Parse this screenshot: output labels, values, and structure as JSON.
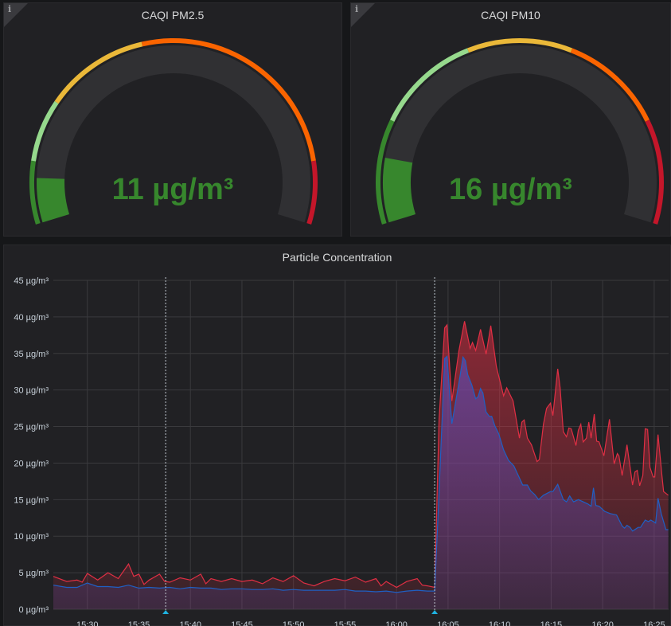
{
  "gauges": [
    {
      "title": "CAQI PM2.5",
      "value": 11,
      "value_text": "11 µg/m³",
      "max": 125,
      "thresholds": [
        {
          "to": 15,
          "color": "#37872d"
        },
        {
          "to": 30,
          "color": "#96d98d"
        },
        {
          "to": 55,
          "color": "#eab839"
        },
        {
          "to": 110,
          "color": "#fa6400"
        },
        {
          "to": 125,
          "color": "#c4162a"
        }
      ],
      "value_color": "#37872d",
      "info_icon": "i"
    },
    {
      "title": "CAQI PM10",
      "value": 16,
      "value_text": "16 µg/m³",
      "max": 125,
      "thresholds": [
        {
          "to": 25,
          "color": "#37872d"
        },
        {
          "to": 50,
          "color": "#96d98d"
        },
        {
          "to": 75,
          "color": "#eab839"
        },
        {
          "to": 100,
          "color": "#fa6400"
        },
        {
          "to": 125,
          "color": "#c4162a"
        }
      ],
      "value_color": "#37872d",
      "info_icon": "i"
    }
  ],
  "chart_data": {
    "type": "area",
    "title": "Particle Concentration",
    "x_unit": "minutes after 15:00",
    "xlim": [
      26.7,
      86.4
    ],
    "ylim": [
      0,
      45
    ],
    "ytick_labels": [
      "0 µg/m³",
      "5 µg/m³",
      "10 µg/m³",
      "15 µg/m³",
      "20 µg/m³",
      "25 µg/m³",
      "30 µg/m³",
      "35 µg/m³",
      "40 µg/m³",
      "45 µg/m³"
    ],
    "yticks": [
      0,
      5,
      10,
      15,
      20,
      25,
      30,
      35,
      40,
      45
    ],
    "xticks": [
      30,
      35,
      40,
      45,
      50,
      55,
      60,
      65,
      70,
      75,
      80,
      85
    ],
    "xtick_labels": [
      "15:30",
      "15:35",
      "15:40",
      "15:45",
      "15:50",
      "15:55",
      "16:00",
      "16:05",
      "16:10",
      "16:15",
      "16:20",
      "16:25"
    ],
    "annotations": [
      37.6,
      63.7
    ],
    "grid": true,
    "series": [
      {
        "color": "#e02f44",
        "points": [
          [
            26.7,
            4.5
          ],
          [
            28,
            3.8
          ],
          [
            29,
            4.0
          ],
          [
            29.5,
            3.7
          ],
          [
            30,
            4.9
          ],
          [
            31,
            4.0
          ],
          [
            32,
            5.0
          ],
          [
            33,
            4.2
          ],
          [
            34,
            6.2
          ],
          [
            34.5,
            4.5
          ],
          [
            35,
            4.8
          ],
          [
            35.5,
            3.4
          ],
          [
            36,
            4.0
          ],
          [
            37,
            4.8
          ],
          [
            37.5,
            3.8
          ],
          [
            38,
            3.7
          ],
          [
            39,
            4.3
          ],
          [
            40,
            4.0
          ],
          [
            41,
            4.8
          ],
          [
            41.5,
            3.5
          ],
          [
            42,
            4.2
          ],
          [
            43,
            3.8
          ],
          [
            44,
            4.2
          ],
          [
            45,
            3.8
          ],
          [
            46,
            4.0
          ],
          [
            47,
            3.5
          ],
          [
            48,
            4.3
          ],
          [
            49,
            3.8
          ],
          [
            50,
            4.6
          ],
          [
            51,
            3.6
          ],
          [
            52,
            3.2
          ],
          [
            53,
            3.8
          ],
          [
            54,
            4.2
          ],
          [
            55,
            3.9
          ],
          [
            56,
            4.4
          ],
          [
            57,
            3.7
          ],
          [
            58,
            4.2
          ],
          [
            58.5,
            3.2
          ],
          [
            59,
            3.8
          ],
          [
            60,
            3.0
          ],
          [
            61,
            3.8
          ],
          [
            62,
            4.2
          ],
          [
            62.5,
            3.3
          ],
          [
            63,
            3.2
          ],
          [
            63.7,
            3.0
          ],
          [
            64.13,
            25.9
          ],
          [
            64.67,
            38.5
          ],
          [
            64.9,
            38.9
          ],
          [
            65.37,
            28.5
          ],
          [
            66.06,
            35.4
          ],
          [
            66.6,
            39.4
          ],
          [
            67.14,
            35.7
          ],
          [
            67.37,
            36.5
          ],
          [
            67.68,
            35.4
          ],
          [
            68.15,
            38.3
          ],
          [
            68.69,
            34.9
          ],
          [
            69.15,
            38.8
          ],
          [
            69.69,
            33.2
          ],
          [
            70.39,
            29.2
          ],
          [
            70.69,
            30.3
          ],
          [
            71.31,
            28.5
          ],
          [
            71.93,
            23.4
          ],
          [
            72.16,
            25.6
          ],
          [
            72.39,
            25.9
          ],
          [
            72.7,
            23.4
          ],
          [
            73.09,
            22.5
          ],
          [
            73.63,
            20.2
          ],
          [
            73.86,
            20.5
          ],
          [
            74.25,
            25.3
          ],
          [
            74.56,
            27.5
          ],
          [
            74.94,
            28.2
          ],
          [
            75.17,
            26.5
          ],
          [
            75.64,
            32.9
          ],
          [
            75.87,
            30.3
          ],
          [
            76.18,
            24.3
          ],
          [
            76.49,
            23.6
          ],
          [
            76.72,
            24.8
          ],
          [
            76.95,
            24.7
          ],
          [
            77.41,
            22.4
          ],
          [
            77.64,
            24.5
          ],
          [
            77.88,
            25.3
          ],
          [
            78.11,
            22.9
          ],
          [
            78.42,
            23.4
          ],
          [
            78.65,
            25.6
          ],
          [
            78.88,
            23.4
          ],
          [
            79.19,
            26.7
          ],
          [
            79.42,
            23.0
          ],
          [
            79.65,
            22.9
          ],
          [
            80.12,
            21.0
          ],
          [
            80.66,
            26.0
          ],
          [
            81.12,
            19.9
          ],
          [
            81.43,
            21.3
          ],
          [
            81.58,
            21.0
          ],
          [
            81.89,
            18.3
          ],
          [
            82.36,
            22.5
          ],
          [
            82.9,
            17.0
          ],
          [
            83.13,
            18.8
          ],
          [
            83.36,
            19.0
          ],
          [
            83.59,
            16.9
          ],
          [
            83.9,
            18.3
          ],
          [
            84.13,
            24.7
          ],
          [
            84.36,
            24.6
          ],
          [
            84.59,
            19.4
          ],
          [
            84.9,
            18.1
          ],
          [
            85.06,
            18.1
          ],
          [
            85.37,
            23.9
          ],
          [
            85.75,
            18.3
          ],
          [
            85.91,
            16.1
          ],
          [
            86.37,
            15.6
          ]
        ]
      },
      {
        "color": "#1f60c4",
        "points": [
          [
            26.7,
            3.3
          ],
          [
            28,
            3.0
          ],
          [
            29,
            3.0
          ],
          [
            30,
            3.6
          ],
          [
            31,
            3.1
          ],
          [
            32,
            3.1
          ],
          [
            33,
            3.0
          ],
          [
            34,
            3.3
          ],
          [
            35,
            2.9
          ],
          [
            36,
            3.0
          ],
          [
            37,
            2.9
          ],
          [
            38,
            3.0
          ],
          [
            39,
            2.8
          ],
          [
            40,
            3.0
          ],
          [
            41,
            2.9
          ],
          [
            42,
            2.9
          ],
          [
            43,
            2.7
          ],
          [
            44,
            2.8
          ],
          [
            45,
            2.8
          ],
          [
            46,
            2.7
          ],
          [
            47,
            2.7
          ],
          [
            48,
            2.8
          ],
          [
            49,
            2.6
          ],
          [
            50,
            2.7
          ],
          [
            51,
            2.6
          ],
          [
            52,
            2.6
          ],
          [
            53,
            2.6
          ],
          [
            54,
            2.6
          ],
          [
            55,
            2.7
          ],
          [
            56,
            2.5
          ],
          [
            57,
            2.5
          ],
          [
            58,
            2.4
          ],
          [
            59,
            2.5
          ],
          [
            60,
            2.3
          ],
          [
            61,
            2.5
          ],
          [
            62,
            2.6
          ],
          [
            63,
            2.5
          ],
          [
            63.7,
            2.5
          ],
          [
            64.13,
            16.0
          ],
          [
            64.67,
            34.3
          ],
          [
            64.9,
            34.6
          ],
          [
            65.37,
            25.4
          ],
          [
            66.06,
            31.0
          ],
          [
            66.45,
            34.5
          ],
          [
            66.68,
            34.0
          ],
          [
            66.91,
            32.1
          ],
          [
            67.3,
            30.7
          ],
          [
            67.68,
            28.8
          ],
          [
            67.92,
            29.1
          ],
          [
            68.15,
            30.2
          ],
          [
            68.38,
            29.6
          ],
          [
            68.69,
            27.0
          ],
          [
            69.0,
            26.4
          ],
          [
            69.23,
            26.4
          ],
          [
            69.54,
            25.1
          ],
          [
            69.92,
            24.0
          ],
          [
            70.39,
            21.8
          ],
          [
            70.85,
            20.4
          ],
          [
            71.39,
            19.6
          ],
          [
            71.85,
            18.2
          ],
          [
            72.24,
            17.0
          ],
          [
            72.7,
            17.0
          ],
          [
            73.01,
            16.2
          ],
          [
            73.4,
            15.7
          ],
          [
            73.78,
            15.0
          ],
          [
            74.25,
            15.6
          ],
          [
            74.94,
            16.1
          ],
          [
            75.17,
            16.1
          ],
          [
            75.64,
            17.1
          ],
          [
            76.18,
            15.0
          ],
          [
            76.49,
            14.7
          ],
          [
            76.8,
            15.5
          ],
          [
            77.18,
            14.7
          ],
          [
            77.64,
            15.0
          ],
          [
            78.11,
            14.7
          ],
          [
            78.57,
            14.4
          ],
          [
            78.88,
            14.1
          ],
          [
            79.11,
            16.6
          ],
          [
            79.34,
            14.2
          ],
          [
            79.65,
            14.1
          ],
          [
            80.19,
            13.4
          ],
          [
            80.73,
            13.1
          ],
          [
            81.35,
            12.9
          ],
          [
            81.89,
            11.4
          ],
          [
            82.12,
            11.1
          ],
          [
            82.36,
            11.5
          ],
          [
            82.66,
            11.2
          ],
          [
            82.9,
            10.7
          ],
          [
            83.44,
            11.2
          ],
          [
            83.67,
            11.2
          ],
          [
            84.13,
            12.2
          ],
          [
            84.44,
            12.0
          ],
          [
            84.67,
            12.2
          ],
          [
            85.14,
            11.8
          ],
          [
            85.37,
            15.2
          ],
          [
            85.68,
            13.1
          ],
          [
            86.14,
            10.9
          ],
          [
            86.37,
            10.9
          ]
        ]
      }
    ]
  }
}
